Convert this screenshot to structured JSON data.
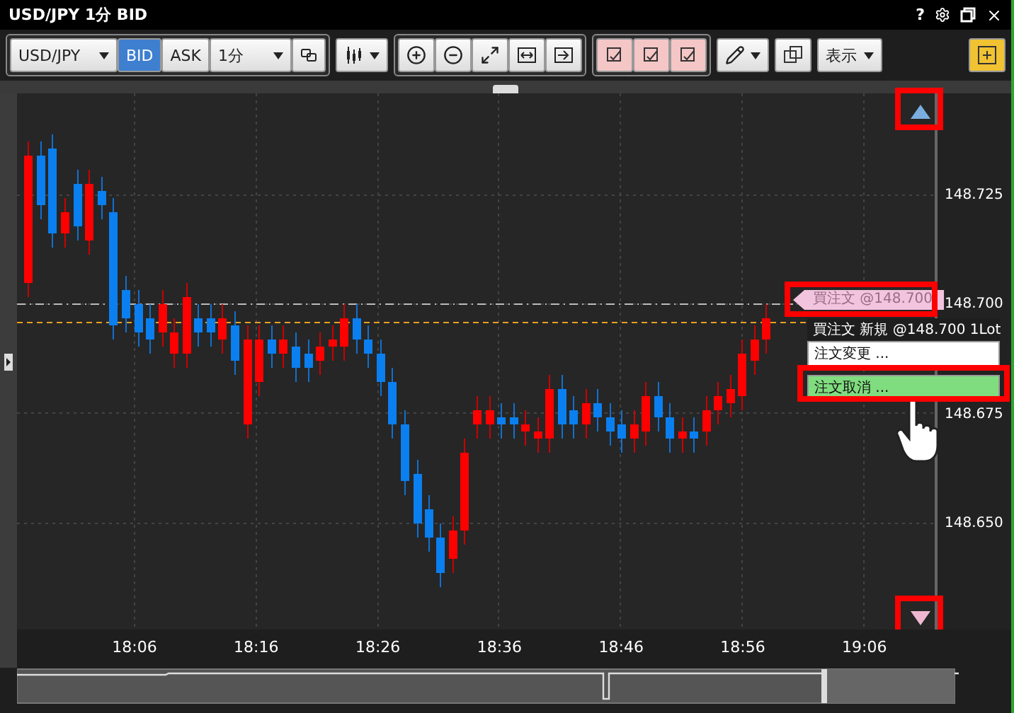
{
  "window": {
    "title": "USD/JPY 1分 BID",
    "help": "?"
  },
  "toolbar": {
    "symbol": "USD/JPY",
    "price_sides": [
      {
        "label": "BID",
        "selected": true
      },
      {
        "label": "ASK",
        "selected": false
      }
    ],
    "timeframe": "1分",
    "view_menu": "表示"
  },
  "chart": {
    "price_labels": [
      "148.725",
      "148.700",
      "148.675",
      "148.650"
    ],
    "time_labels": [
      "18:06",
      "18:16",
      "18:26",
      "18:36",
      "18:46",
      "18:56",
      "19:06"
    ],
    "order_tag": "買注文 @148.700",
    "context_menu": {
      "header": "買注文 新規 @148.700 1Lot",
      "items": [
        {
          "label": "注文変更 ...",
          "selected": false
        },
        {
          "label": "注文取消 ...",
          "selected": true
        }
      ]
    }
  }
}
